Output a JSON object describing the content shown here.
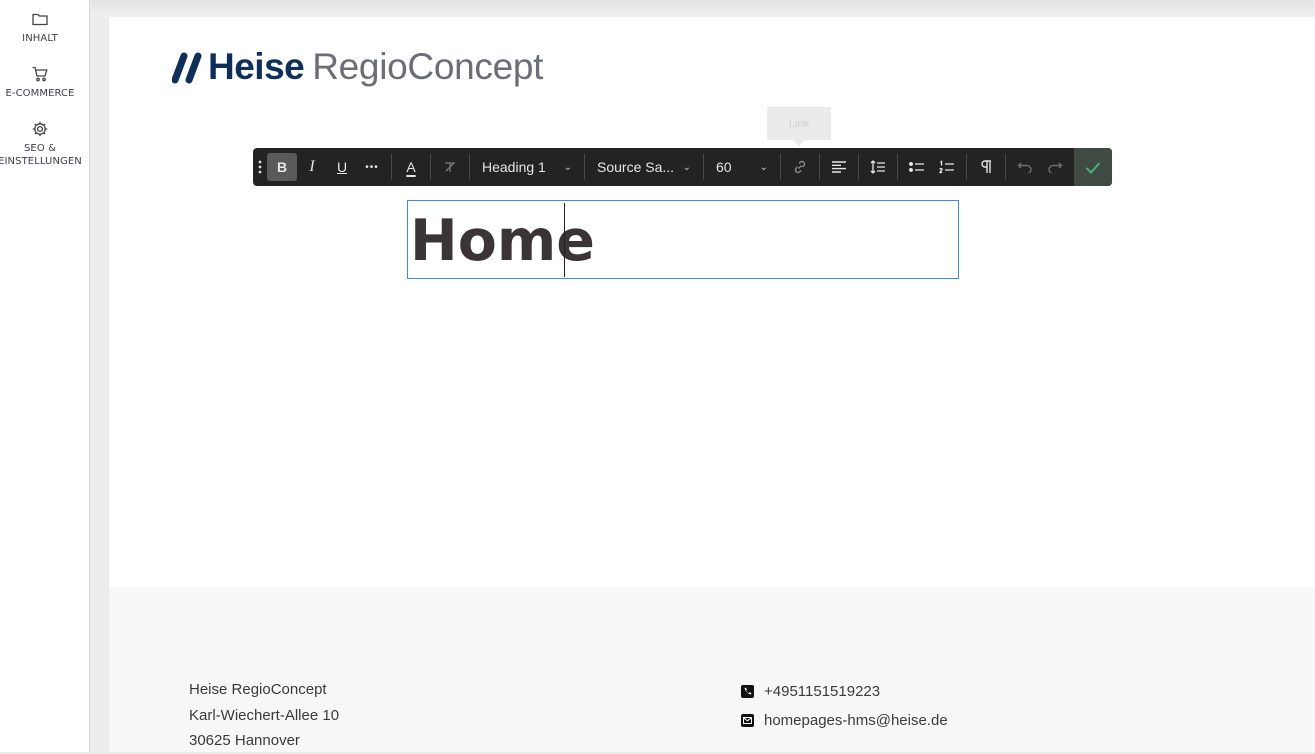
{
  "sidebar": {
    "items": [
      {
        "label": "INHALT",
        "icon": "folder-icon"
      },
      {
        "label": "E-COMMERCE",
        "icon": "cart-icon"
      },
      {
        "label": "SEO & EINSTELLUNGEN",
        "icon": "gear-icon"
      }
    ]
  },
  "logo": {
    "part1": "Heise",
    "part2": "RegioConcept",
    "brand_color": "#0e2f5a"
  },
  "tooltip": {
    "text": "Link"
  },
  "toolbar": {
    "bold": "B",
    "italic": "I",
    "underline": "U",
    "more": "•••",
    "text_color": "A",
    "block_format": "Heading 1",
    "font_family": "Source Sa...",
    "font_size": "60",
    "confirm_color": "#4caf7a"
  },
  "editor": {
    "heading": "Home",
    "focus_color": "#3b8ed6"
  },
  "footer": {
    "address": [
      "Heise RegioConcept",
      "Karl-Wiechert-Allee 10",
      "30625 Hannover"
    ],
    "phone": "+4951151519223",
    "email": "homepages-hms@heise.de"
  }
}
